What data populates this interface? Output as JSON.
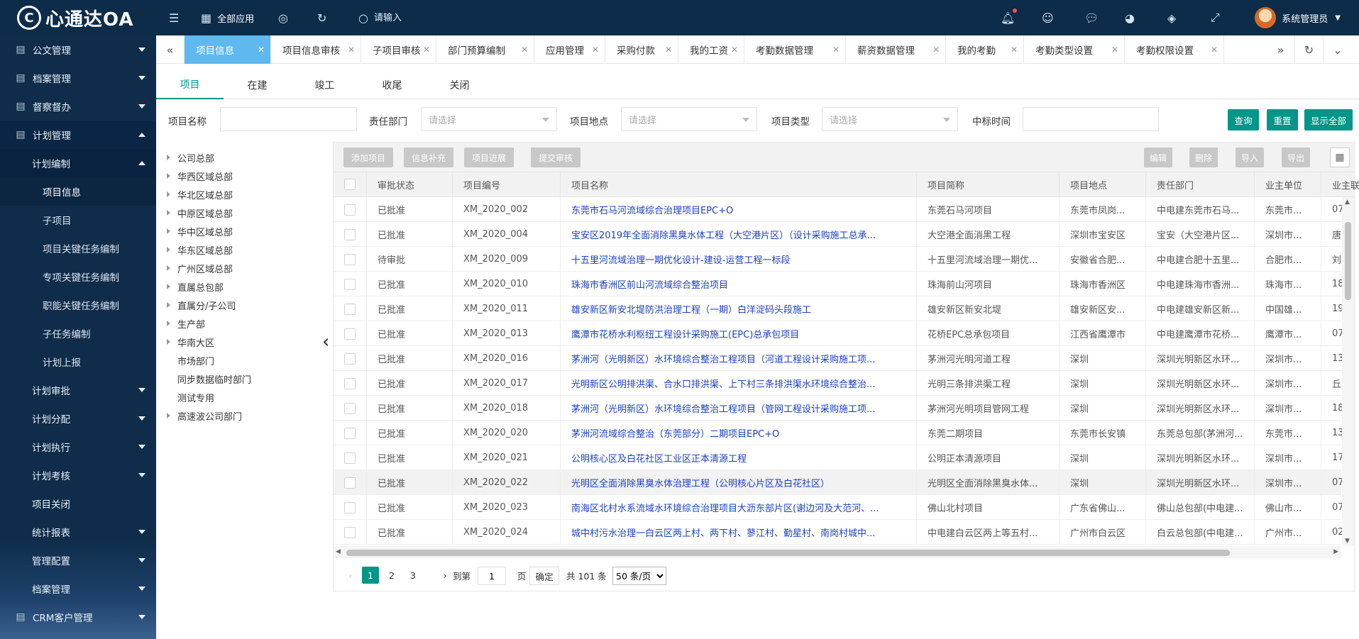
{
  "app": {
    "logo_mark": "C",
    "title": "心通达OA"
  },
  "topbar": {
    "all_apps_label": "全部应用",
    "search_placeholder": "请输入",
    "user_name": "系统管理员"
  },
  "sidebar": {
    "items": [
      {
        "label": "公文管理",
        "icon": "document-icon",
        "level": 1,
        "expanded": false
      },
      {
        "label": "档案管理",
        "icon": "archive-icon",
        "level": 1,
        "expanded": false
      },
      {
        "label": "督察督办",
        "icon": "supervision-icon",
        "level": 1,
        "expanded": false
      },
      {
        "label": "计划管理",
        "icon": "plan-icon",
        "level": 1,
        "expanded": true
      },
      {
        "label": "计划编制",
        "level": 2,
        "expanded": true
      },
      {
        "label": "项目信息",
        "level": 3,
        "selected": true
      },
      {
        "label": "子项目",
        "level": 3
      },
      {
        "label": "项目关键任务编制",
        "level": 3
      },
      {
        "label": "专项关键任务编制",
        "level": 3
      },
      {
        "label": "职能关键任务编制",
        "level": 3
      },
      {
        "label": "子任务编制",
        "level": 3
      },
      {
        "label": "计划上报",
        "level": 3
      },
      {
        "label": "计划审批",
        "level": 2,
        "expanded": false
      },
      {
        "label": "计划分配",
        "level": 2,
        "expanded": false
      },
      {
        "label": "计划执行",
        "level": 2,
        "expanded": false
      },
      {
        "label": "计划考核",
        "level": 2,
        "expanded": false
      },
      {
        "label": "项目关闭",
        "level": 2
      },
      {
        "label": "统计报表",
        "level": 2,
        "expanded": false
      },
      {
        "label": "管理配置",
        "level": 2,
        "expanded": false
      },
      {
        "label": "档案管理",
        "level": 2,
        "expanded": false
      },
      {
        "label": "CRM客户管理",
        "icon": "crm-icon",
        "level": 1,
        "expanded": false
      }
    ]
  },
  "tabs": [
    {
      "label": "项目信息",
      "active": true
    },
    {
      "label": "项目信息审核"
    },
    {
      "label": "子项目审核"
    },
    {
      "label": "部门预算编制"
    },
    {
      "label": "应用管理"
    },
    {
      "label": "采购付款"
    },
    {
      "label": "我的工资"
    },
    {
      "label": "考勤数据管理"
    },
    {
      "label": "薪资数据管理"
    },
    {
      "label": "我的考勤"
    },
    {
      "label": "考勤类型设置"
    },
    {
      "label": "考勤权限设置"
    }
  ],
  "subtabs": [
    "项目",
    "在建",
    "竣工",
    "收尾",
    "关闭"
  ],
  "filters": {
    "project_name_label": "项目名称",
    "dept_label": "责任部门",
    "dept_placeholder": "请选择",
    "location_label": "项目地点",
    "location_placeholder": "请选择",
    "type_label": "项目类型",
    "type_placeholder": "请选择",
    "bid_time_label": "中标时间",
    "query_label": "查询",
    "reset_label": "重置",
    "show_all_label": "显示全部"
  },
  "tree": [
    {
      "label": "公司总部",
      "has_children": true
    },
    {
      "label": "华西区域总部",
      "has_children": true
    },
    {
      "label": "华北区域总部",
      "has_children": true
    },
    {
      "label": "中原区域总部",
      "has_children": true
    },
    {
      "label": "华中区域总部",
      "has_children": true
    },
    {
      "label": "华东区域总部",
      "has_children": true
    },
    {
      "label": "广州区域总部",
      "has_children": true
    },
    {
      "label": "直属总包部",
      "has_children": true
    },
    {
      "label": "直属分/子公司",
      "has_children": true
    },
    {
      "label": "生产部",
      "has_children": true
    },
    {
      "label": "华南大区",
      "has_children": true
    },
    {
      "label": "市场部门",
      "has_children": false
    },
    {
      "label": "同步数据临时部门",
      "has_children": false
    },
    {
      "label": "测试专用",
      "has_children": false
    },
    {
      "label": "高速波公司部门",
      "has_children": true
    }
  ],
  "toolbar": {
    "left": [
      "添加项目",
      "信息补充",
      "项目进展",
      "提交审核"
    ],
    "right": [
      "编辑",
      "删除",
      "导入",
      "导出"
    ]
  },
  "table": {
    "columns": [
      "审批状态",
      "项目编号",
      "项目名称",
      "项目简称",
      "项目地点",
      "责任部门",
      "业主单位",
      "业主联"
    ],
    "rows": [
      [
        "已批准",
        "XM_2020_002",
        "东莞市石马河流域综合治理项目EPC+O",
        "东莞石马河项目",
        "东莞市凤岗...",
        "中电建东莞市石马...",
        "东莞市...",
        "07"
      ],
      [
        "已批准",
        "XM_2020_004",
        "宝安区2019年全面消除黑臭水体工程（大空港片区）（设计采购施工总承...",
        "大空港全面消黑工程",
        "深圳市宝安区",
        "宝安（大空港片区...",
        "深圳市...",
        "唐"
      ],
      [
        "待审批",
        "XM_2020_009",
        "十五里河流域治理一期优化设计-建设-运营工程一标段",
        "十五里河流域治理一期优...",
        "安徽省合肥...",
        "中电建合肥十五里...",
        "合肥市...",
        "刘"
      ],
      [
        "已批准",
        "XM_2020_010",
        "珠海市香洲区前山河流域综合整治项目",
        "珠海前山河项目",
        "珠海市香洲区",
        "中电建珠海市香洲...",
        "珠海市...",
        "18"
      ],
      [
        "已批准",
        "XM_2020_011",
        "雄安新区新安北堤防洪治理工程（一期）白洋淀码头段施工",
        "雄安新区新安北堤",
        "雄安新区安...",
        "中电建雄安新区新...",
        "中国雄...",
        "19"
      ],
      [
        "已批准",
        "XM_2020_013",
        "鹰潭市花桥水利枢纽工程设计采购施工(EPC)总承包项目",
        "花桥EPC总承包项目",
        "江西省鹰潭市",
        "中电建鹰潭市花桥...",
        "鹰潭市...",
        "07"
      ],
      [
        "已批准",
        "XM_2020_016",
        "茅洲河（光明新区）水环境综合整治工程项目（河道工程设计采购施工项...",
        "茅洲河光明河道工程",
        "深圳",
        "深圳光明新区水环...",
        "深圳市...",
        "13"
      ],
      [
        "已批准",
        "XM_2020_017",
        "光明新区公明排洪渠、合水口排洪渠、上下村三条排洪渠水环境综合整治...",
        "光明三条排洪渠工程",
        "深圳",
        "深圳光明新区水环...",
        "深圳市...",
        "丘"
      ],
      [
        "已批准",
        "XM_2020_018",
        "茅洲河（光明新区）水环境综合整治工程项目（管网工程设计采购施工项...",
        "茅洲河光明项目管网工程",
        "深圳",
        "深圳光明新区水环...",
        "深圳市...",
        "18"
      ],
      [
        "已批准",
        "XM_2020_020",
        "茅洲河流域综合整治（东莞部分）二期项目EPC+O",
        "东莞二期项目",
        "东莞市长安镇",
        "东莞总包部(茅洲河...",
        "东莞市...",
        "13"
      ],
      [
        "已批准",
        "XM_2020_021",
        "公明核心区及白花社区工业区正本清源工程",
        "公明正本清源项目",
        "深圳",
        "深圳光明新区水环...",
        "深圳市...",
        "17"
      ],
      [
        "已批准",
        "XM_2020_022",
        "光明区全面消除黑臭水体治理工程（公明核心片区及白花社区）",
        "光明区全面消除黑臭水体...",
        "深圳",
        "深圳光明新区水环...",
        "深圳市...",
        "07"
      ],
      [
        "已批准",
        "XM_2020_023",
        "南海区北村水系流域水环境综合治理项目大沥东部片区(谢边河及大范河、...",
        "佛山北村项目",
        "广东省佛山...",
        "佛山总包部(中电建...",
        "佛山市...",
        "07"
      ],
      [
        "已批准",
        "XM_2020_024",
        "城中村污水治理一白云区两上村、两下村、蓼江村、勤星村、南岗村城中...",
        "中电建白云区两上等五村...",
        "广州市白云区",
        "白云总包部(中电建...",
        "广州市...",
        "02"
      ]
    ],
    "hover_row": 11
  },
  "pager": {
    "pages": [
      "1",
      "2",
      "3"
    ],
    "current": "1",
    "goto_label": "到第",
    "goto_value": "1",
    "page_unit": "页",
    "confirm_label": "确定",
    "total_label": "共 101 条",
    "page_size": "50 条/页"
  },
  "colors": {
    "sidebar_bg": "#0f2d4b",
    "topbar_bg": "#0c2c4a",
    "accent": "#009688",
    "active_tab": "#5fb9ee",
    "link": "#1a3fc8"
  }
}
